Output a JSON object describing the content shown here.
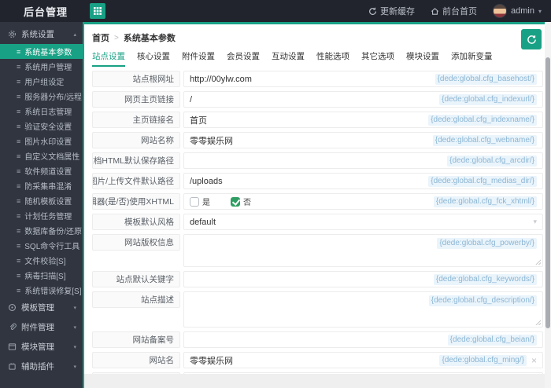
{
  "header": {
    "title": "后台管理",
    "actions": [
      {
        "icon": "refresh-icon",
        "label": "更新缓存"
      },
      {
        "icon": "home-icon",
        "label": "前台首页"
      }
    ],
    "user": {
      "name": "admin"
    }
  },
  "sidebar": {
    "groups": [
      {
        "key": "system",
        "label": "系统设置",
        "icon": "gear",
        "expanded": true,
        "items": [
          {
            "label": "系统基本参数",
            "active": true
          },
          {
            "label": "系统用户管理",
            "active": false
          },
          {
            "label": "用户组设定",
            "active": false
          },
          {
            "label": "服务器分布/远程",
            "active": false
          },
          {
            "label": "系统日志管理",
            "active": false
          },
          {
            "label": "验证安全设置",
            "active": false
          },
          {
            "label": "图片水印设置",
            "active": false
          },
          {
            "label": "自定义文档属性",
            "active": false
          },
          {
            "label": "软件频道设置",
            "active": false
          },
          {
            "label": "防采集串混淆",
            "active": false
          },
          {
            "label": "随机模板设置",
            "active": false
          },
          {
            "label": "计划任务管理",
            "active": false
          },
          {
            "label": "数据库备份/还原",
            "active": false
          },
          {
            "label": "SQL命令行工具",
            "active": false
          },
          {
            "label": "文件校验[S]",
            "active": false
          },
          {
            "label": "病毒扫描[S]",
            "active": false
          },
          {
            "label": "系统错误修复[S]",
            "active": false
          }
        ]
      },
      {
        "key": "template",
        "label": "模板管理",
        "icon": "palette",
        "expanded": false,
        "items": []
      },
      {
        "key": "attachment",
        "label": "附件管理",
        "icon": "paperclip",
        "expanded": false,
        "items": []
      },
      {
        "key": "module",
        "label": "模块管理",
        "icon": "window",
        "expanded": false,
        "items": []
      },
      {
        "key": "plugin",
        "label": "辅助插件",
        "icon": "plugin",
        "expanded": false,
        "items": []
      }
    ]
  },
  "breadcrumb": {
    "home": "首页",
    "current": "系统基本参数"
  },
  "tabs": {
    "active_index": 0,
    "items": [
      "站点设置",
      "核心设置",
      "附件设置",
      "会员设置",
      "互动设置",
      "性能选项",
      "其它选项",
      "模块设置",
      "添加新变量"
    ]
  },
  "form": {
    "rows": [
      {
        "type": "input",
        "label": "站点根网址",
        "value": "http://00ylw.com",
        "tag": "{dede:global.cfg_basehost/}"
      },
      {
        "type": "input",
        "label": "网页主页链接",
        "value": "/",
        "tag": "{dede:global.cfg_indexurl/}"
      },
      {
        "type": "input",
        "label": "主页链接名",
        "value": "首页",
        "tag": "{dede:global.cfg_indexname/}"
      },
      {
        "type": "input",
        "label": "网站名称",
        "value": "零零娱乐网",
        "tag": "{dede:global.cfg_webname/}"
      },
      {
        "type": "input",
        "label": "文档HTML默认保存路径",
        "value": "",
        "tag": "{dede:global.cfg_arcdir/}"
      },
      {
        "type": "input",
        "label": "图片/上传文件默认路径",
        "value": "/uploads",
        "tag": "{dede:global.cfg_medias_dir/}"
      },
      {
        "type": "radio",
        "label": "编辑器(是/否)使用XHTML",
        "tag": "{dede:global.cfg_fck_xhtml/}",
        "options": [
          {
            "label": "是",
            "checked": false
          },
          {
            "label": "否",
            "checked": true
          }
        ]
      },
      {
        "type": "select",
        "label": "模板默认风格",
        "value": "default",
        "tag": ""
      },
      {
        "type": "textarea",
        "label": "网站版权信息",
        "value": "",
        "tag": "{dede:global.cfg_powerby/}",
        "h": 42
      },
      {
        "type": "input",
        "label": "站点默认关键字",
        "value": "",
        "tag": "{dede:global.cfg_keywords/}"
      },
      {
        "type": "textarea",
        "label": "站点描述",
        "value": "",
        "tag": "{dede:global.cfg_description/}",
        "h": 46
      },
      {
        "type": "input",
        "label": "网站备案号",
        "value": "",
        "tag": "{dede:global.cfg_beian/}"
      },
      {
        "type": "input",
        "label": "网站名",
        "value": "零零娱乐网",
        "tag": "{dede:global.cfg_ming/}",
        "clearable": true
      },
      {
        "type": "input",
        "label": "",
        "value": "",
        "tag": ""
      }
    ]
  },
  "glyphs": {
    "caret_up": "▴",
    "caret_down": "▾",
    "menu": "≡",
    "separator": ">",
    "close": "×",
    "select_caret": "▾"
  },
  "colors": {
    "accent": "#19a185",
    "header_bg": "#21242c",
    "sidebar_bg": "#30353f",
    "panel_bg": "#ffffff",
    "page_bg": "#efefef",
    "tag_text": "#8cb6d4",
    "tag_bg": "#eaf4fb",
    "radio_on": "#2f9e63"
  }
}
